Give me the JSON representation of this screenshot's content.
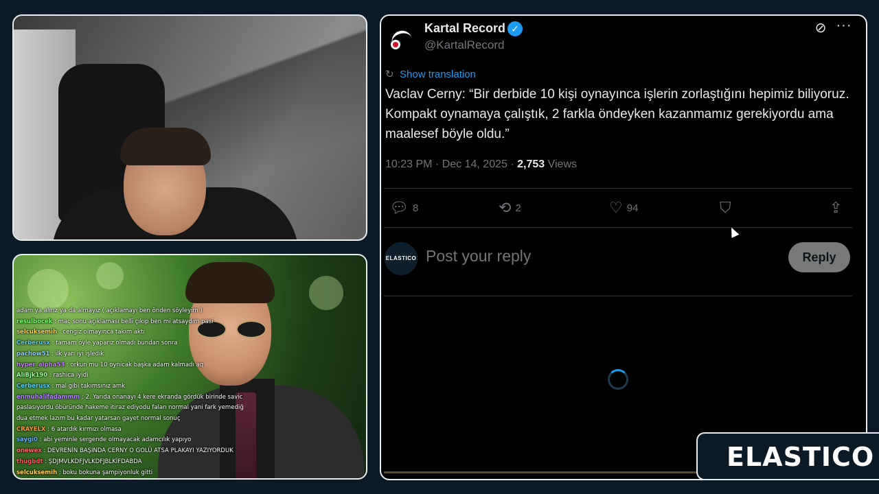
{
  "tweet": {
    "author_name": "Kartal Record",
    "verified_mark": "✓",
    "handle": "@KartalRecord",
    "show_translation": "Show translation",
    "text": "Vaclav Cerny: “Bir derbide 10 kişi oynayınca işlerin zorlaştığını hepimiz biliyoruz. Kompakt oynamaya çalıştık, 2 farkla öndeyken kazanmamız gerekiyordu ama maalesef böyle oldu.”",
    "time": "10:23 PM · Dec 14, 2025 · ",
    "views_count": "2,753",
    "views_label": " Views",
    "replies": "8",
    "retweets": "2",
    "likes": "94",
    "reply_placeholder": "Post your reply",
    "reply_button": "Reply",
    "reply_avatar_text": "ELASTICO"
  },
  "chat": [
    {
      "user": "",
      "color": "#ffffff",
      "text": "adam ya alırız ya da almayız ( açıklamayı ben önden söyleyim )"
    },
    {
      "user": "resulbocek",
      "color": "#7cff6b",
      "text": " : maç sonu açıklaması belli çıkıp ben mi atsaydım pasi"
    },
    {
      "user": "selcuksemih",
      "color": "#ffd34d",
      "text": " : cengiz olmayınca takım aktı"
    },
    {
      "user": "Cerberusx",
      "color": "#4fd3ff",
      "text": " : tamam öyle yaparız olmadı bundan sonra"
    },
    {
      "user": "pachow51",
      "color": "#8cd3ff",
      "text": " : ilk yarı iyi işledik"
    },
    {
      "user": "hyper_alpha53",
      "color": "#c77dff",
      "text": " : orkun mu 10 oynicak başka adam kalmadı aq"
    },
    {
      "user": "AliBjk190",
      "color": "#9cff9c",
      "text": " : rashica iyidi"
    },
    {
      "user": "Cerberusx",
      "color": "#4fd3ff",
      "text": " : mal gibi takımsınız amk"
    },
    {
      "user": "enmuhalifadammm",
      "color": "#b388ff",
      "text": " : 2. Yarıda onanayı 4 kere ekranda gördük birinde savicle"
    },
    {
      "user": "",
      "color": "#ffffff",
      "text": "paslasıyordu öbüründe hakeme itiraz ediyodu falan normal yani fark yemediğimize"
    },
    {
      "user": "",
      "color": "#ffffff",
      "text": "dua etmek lazım bu kadar yatarsan gayet normal sonuç"
    },
    {
      "user": "CRAYELX",
      "color": "#ff9a3c",
      "text": " : 6 atardık kırmızı olmasa"
    },
    {
      "user": "saygi0",
      "color": "#66b2ff",
      "text": " : abi yeminle sergende olmayacak adamcılık yapıyo"
    },
    {
      "user": "onewex",
      "color": "#ff6b6b",
      "text": " : DEVRENİN BAŞINDA CERNY O GOLÜ ATSA PLAKAYI YAZIYORDUK"
    },
    {
      "user": "thugbdt",
      "color": "#ff5a5a",
      "text": " : ŞDJMVLKDFJVLKDFJBLKİFDABDA"
    },
    {
      "user": "selcuksemih",
      "color": "#ffd34d",
      "text": " : boku bokuna şampiyonluk gitti"
    }
  ],
  "logo": {
    "text": "ELASTICO"
  },
  "icons": {
    "reply": "reply-icon",
    "retweet": "retweet-icon",
    "like": "heart-icon",
    "bookmark": "bookmark-icon",
    "share": "share-icon",
    "more": "more-icon",
    "grok": "grok-icon",
    "translate": "translate-icon"
  },
  "colors": {
    "accent": "#1d9bf0",
    "background": "#000000",
    "frame": "#0b1a24"
  }
}
